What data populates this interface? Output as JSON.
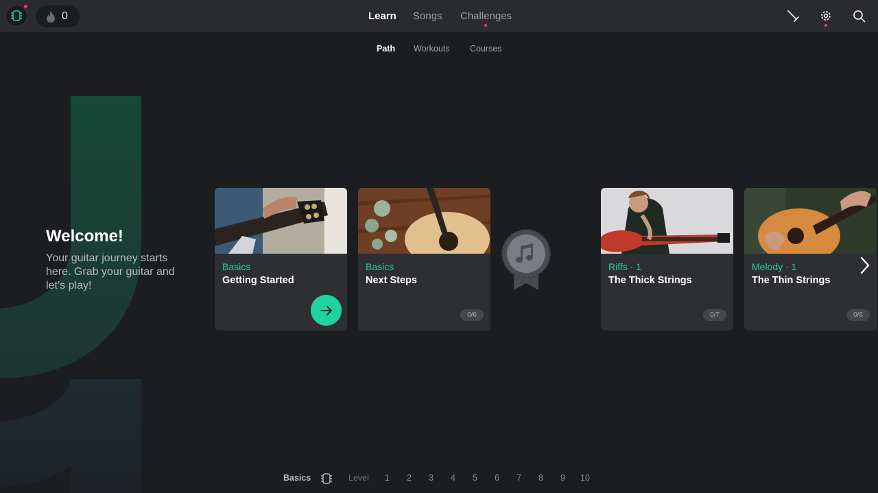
{
  "header": {
    "streak_count": "0",
    "nav": [
      "Learn",
      "Songs",
      "Challenges"
    ],
    "icons": [
      "tuner-icon",
      "settings-icon",
      "search-icon"
    ]
  },
  "subnav": [
    "Path",
    "Workouts",
    "Courses"
  ],
  "welcome": {
    "title": "Welcome!",
    "text": "Your guitar journey starts here. Grab your guitar and let’s play!"
  },
  "cards": [
    {
      "category": "Basics",
      "title": "Getting Started",
      "progress": ""
    },
    {
      "category": "Basics",
      "title": "Next Steps",
      "progress": "0/6"
    },
    {
      "category": "Riffs · 1",
      "title": "The Thick Strings",
      "progress": "0/7"
    },
    {
      "category": "Melody · 1",
      "title": "The Thin Strings",
      "progress": "0/6"
    }
  ],
  "levelbar": {
    "section": "Basics",
    "level_label": "Level",
    "levels": [
      "1",
      "2",
      "3",
      "4",
      "5",
      "6",
      "7",
      "8",
      "9",
      "10"
    ]
  },
  "colors": {
    "accent": "#1fd3a0",
    "background": "#1c1d20",
    "topbar": "#2a2b2f",
    "card": "#2e2f33",
    "notification": "#ef4444"
  }
}
